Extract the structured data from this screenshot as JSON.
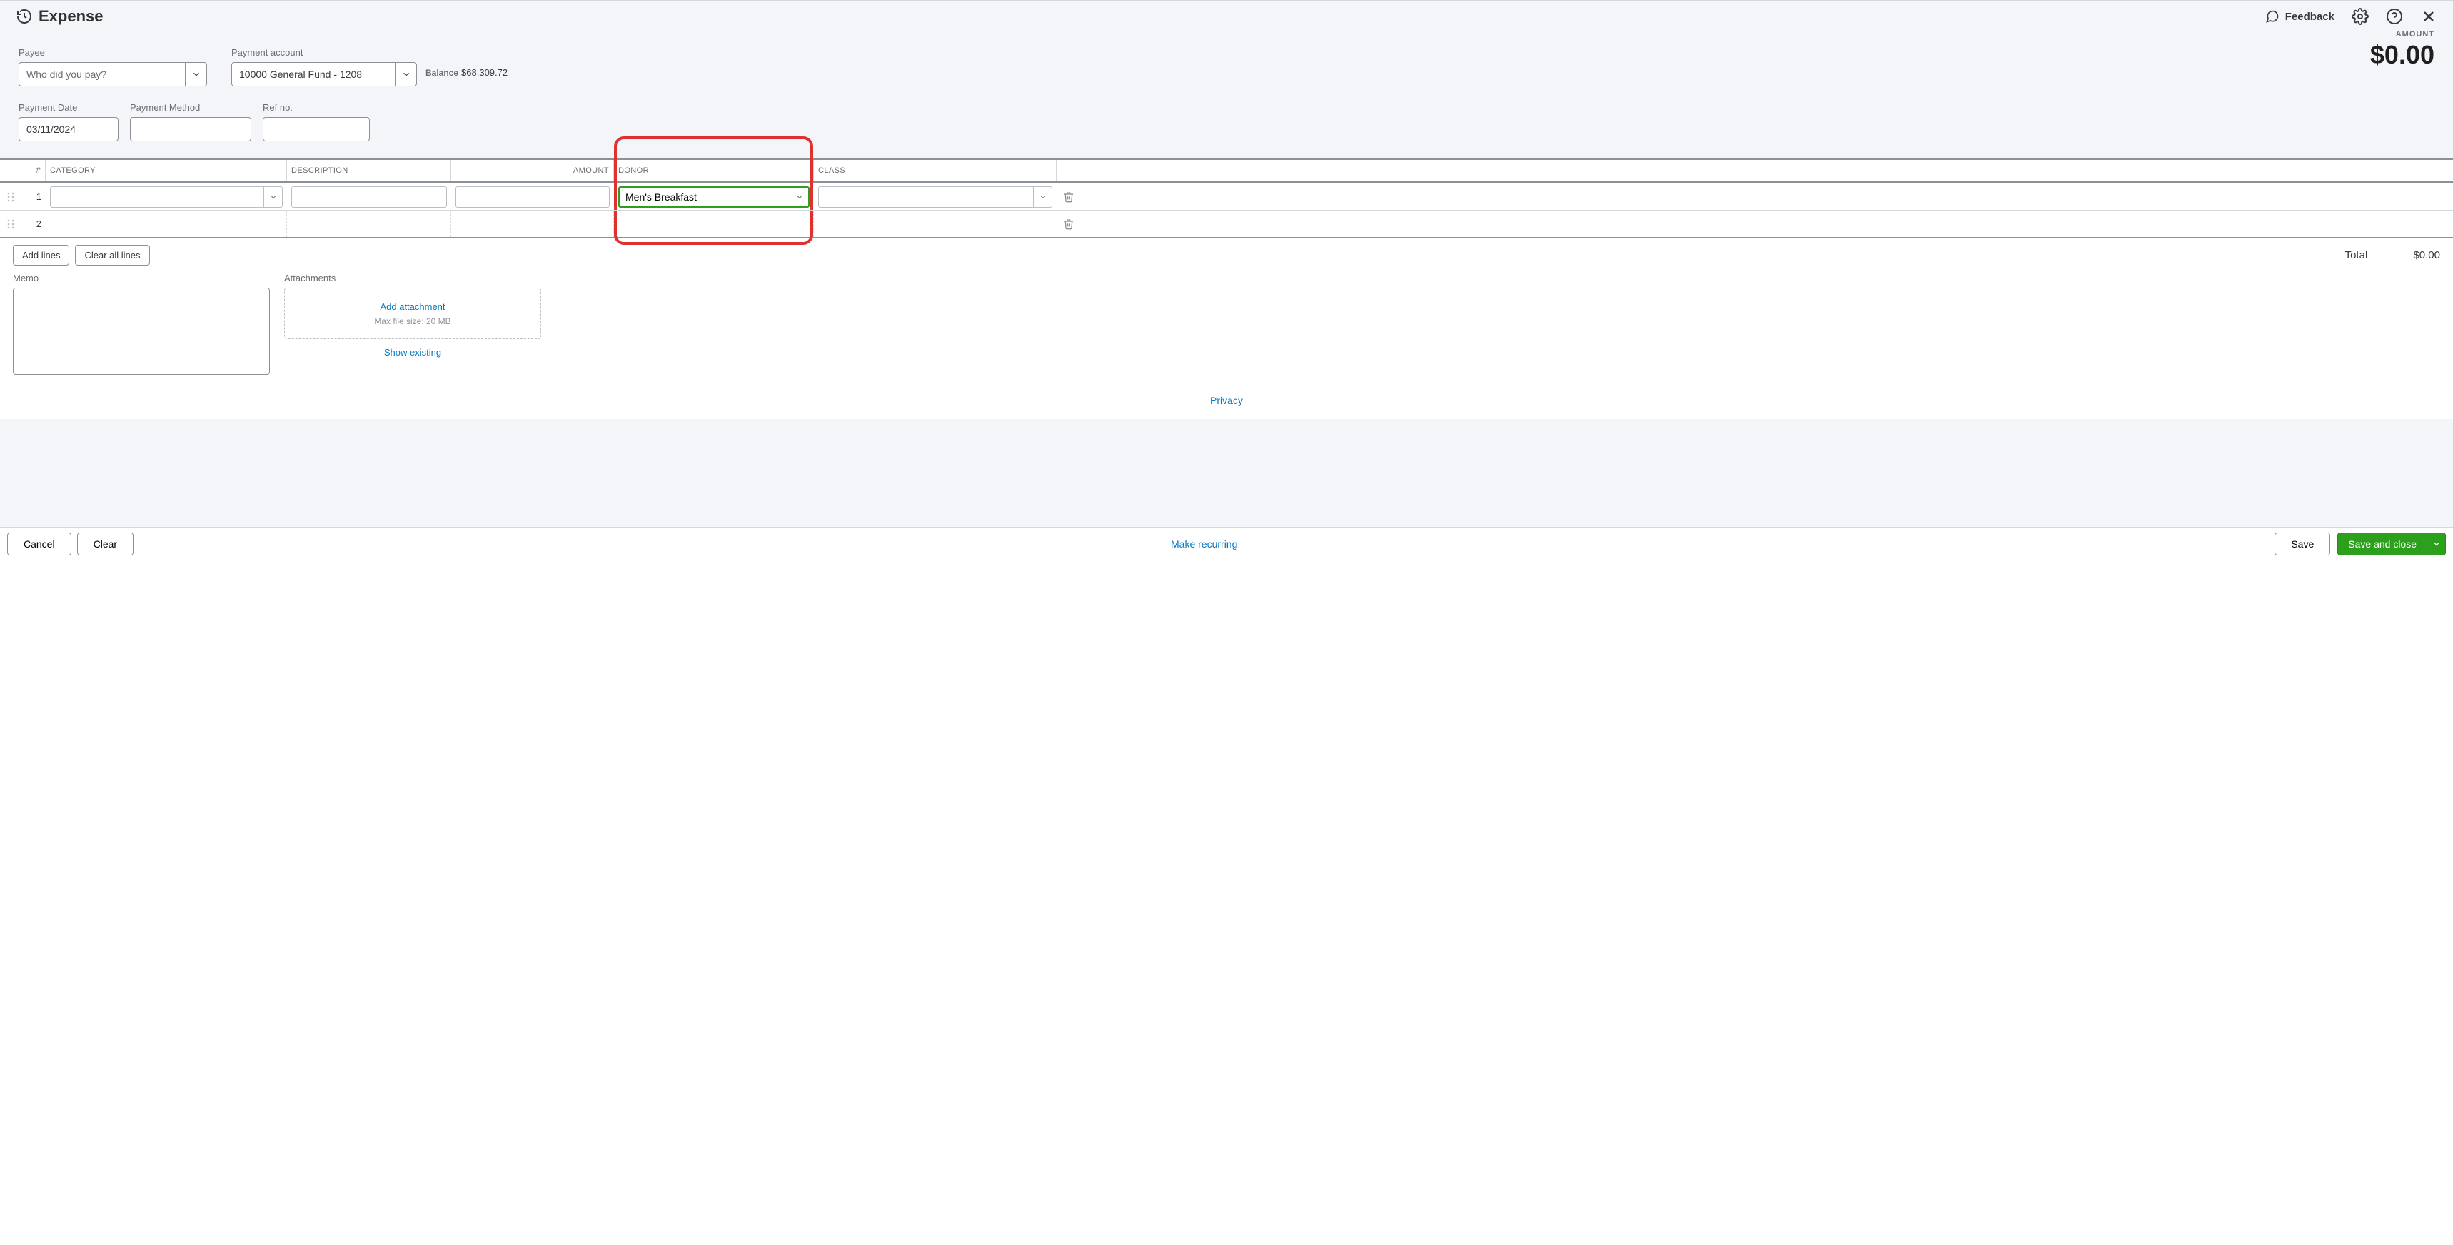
{
  "header": {
    "title": "Expense",
    "feedback": "Feedback"
  },
  "amount": {
    "label": "AMOUNT",
    "value": "$0.00"
  },
  "fields": {
    "payee": {
      "label": "Payee",
      "placeholder": "Who did you pay?",
      "value": ""
    },
    "payment_account": {
      "label": "Payment account",
      "value": "10000 General Fund - 1208"
    },
    "balance": {
      "label": "Balance",
      "value": "$68,309.72"
    },
    "payment_date": {
      "label": "Payment Date",
      "value": "03/11/2024"
    },
    "payment_method": {
      "label": "Payment Method",
      "value": ""
    },
    "ref_no": {
      "label": "Ref no.",
      "value": ""
    }
  },
  "table": {
    "columns": {
      "num": "#",
      "category": "CATEGORY",
      "description": "DESCRIPTION",
      "amount": "AMOUNT",
      "donor": "DONOR",
      "class": "CLASS"
    },
    "rows": [
      {
        "num": "1",
        "category": "",
        "description": "",
        "amount": "",
        "donor": "Men's Breakfast",
        "class": ""
      },
      {
        "num": "2",
        "category": "",
        "description": "",
        "amount": "",
        "donor": "",
        "class": ""
      }
    ],
    "add_lines": "Add lines",
    "clear_all": "Clear all lines",
    "total_label": "Total",
    "total_value": "$0.00"
  },
  "memo": {
    "label": "Memo"
  },
  "attachments": {
    "label": "Attachments",
    "add": "Add attachment",
    "max": "Max file size: 20 MB",
    "show_existing": "Show existing"
  },
  "privacy": "Privacy",
  "footer": {
    "cancel": "Cancel",
    "clear": "Clear",
    "make_recurring": "Make recurring",
    "save": "Save",
    "save_close": "Save and close"
  }
}
